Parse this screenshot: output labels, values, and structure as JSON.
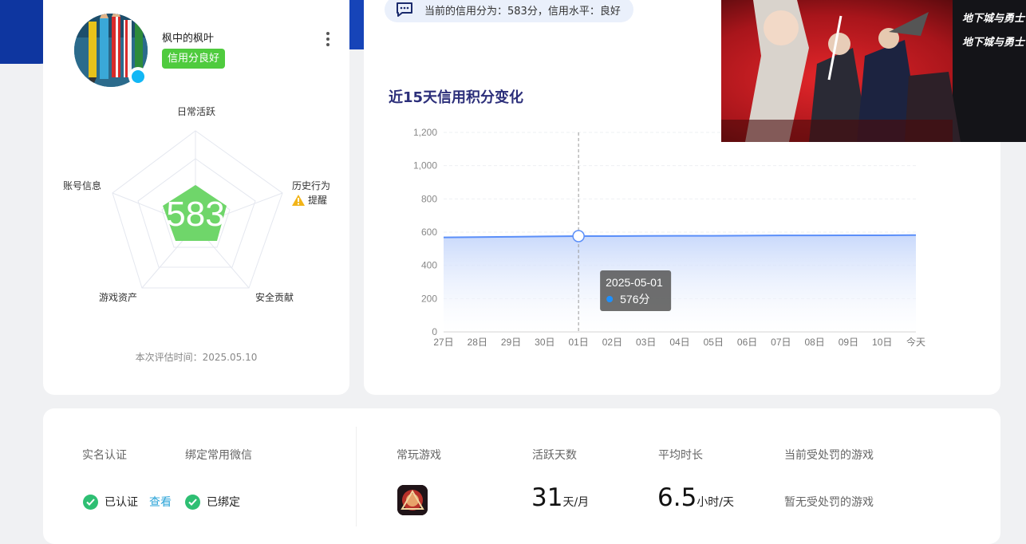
{
  "profile": {
    "username": "枫中的枫叶",
    "credit_badge": "信用分良好",
    "evaluation_time": "本次评估时间：2025.05.10",
    "score_overlay": "583"
  },
  "radar": {
    "labels": {
      "daily": "日常活跃",
      "history": "历史行为",
      "security": "安全贡献",
      "assets": "游戏资产",
      "account": "账号信息"
    },
    "warning_label": "提醒"
  },
  "credit_info": {
    "text": "当前的信用分为：583分，信用水平：良好"
  },
  "chart_title": "近15天信用积分变化",
  "chart_data": {
    "type": "area",
    "x": [
      "27日",
      "28日",
      "29日",
      "30日",
      "01日",
      "02日",
      "03日",
      "04日",
      "05日",
      "06日",
      "07日",
      "08日",
      "09日",
      "10日",
      "今天"
    ],
    "series": [
      {
        "values": [
          568,
          570,
          572,
          574,
          576,
          576,
          577,
          578,
          578,
          579,
          580,
          580,
          581,
          581,
          582
        ]
      }
    ],
    "ylim": [
      0,
      1200
    ],
    "yticks": [
      "0",
      "200",
      "400",
      "600",
      "800",
      "1,000",
      "1,200"
    ],
    "tooltip": {
      "date": "2025-05-01",
      "value": "576分"
    },
    "highlight_index": 4,
    "grid": true,
    "line_color": "#5b8ff9"
  },
  "bottom": {
    "realname_label": "实名认证",
    "wechat_label": "绑定常用微信",
    "realname_status": "已认证",
    "view_link": "查看",
    "wechat_status": "已绑定",
    "frequent_games_label": "常玩游戏",
    "active_days_label": "活跃天数",
    "active_days_value": "31",
    "active_days_unit": "天/月",
    "avg_duration_label": "平均时长",
    "avg_duration_value": "6.5",
    "avg_duration_unit": "小时/天",
    "punished_games_label": "当前受处罚的游戏",
    "punished_games_value": "暂无受处罚的游戏"
  },
  "banner": {
    "logo_text": "地下城与勇士"
  }
}
